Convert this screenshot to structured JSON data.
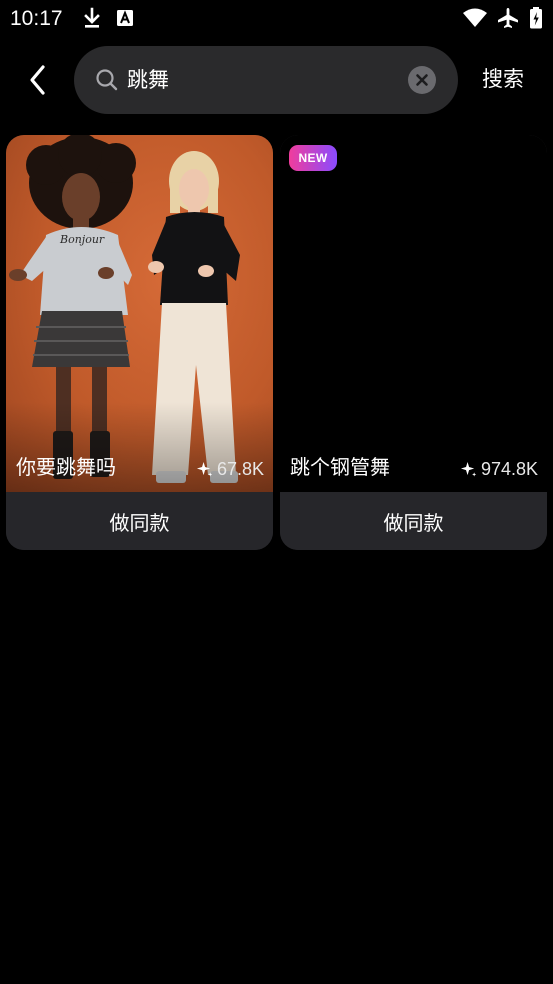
{
  "status_bar": {
    "time": "10:17",
    "icons": [
      "download-icon",
      "font-icon",
      "wifi-icon",
      "airplane-mode-icon",
      "battery-icon"
    ]
  },
  "header": {
    "back_icon": "chevron-left-icon",
    "search": {
      "value": "跳舞",
      "icon": "search-icon",
      "clear_icon": "clear-icon"
    },
    "search_button_label": "搜索"
  },
  "results": [
    {
      "title": "你要跳舞吗",
      "stat": "67.8K",
      "stat_icon": "sparkle-icon",
      "action_label": "做同款",
      "badge": ""
    },
    {
      "title": "跳个钢管舞",
      "stat": "974.8K",
      "stat_icon": "sparkle-icon",
      "action_label": "做同款",
      "badge": "NEW"
    }
  ],
  "colors": {
    "background": "#000000",
    "search_box": "#2a2a2c",
    "card_footer": "#26262a",
    "badge_gradient_start": "#f03d9c",
    "badge_gradient_end": "#8a4bff"
  }
}
